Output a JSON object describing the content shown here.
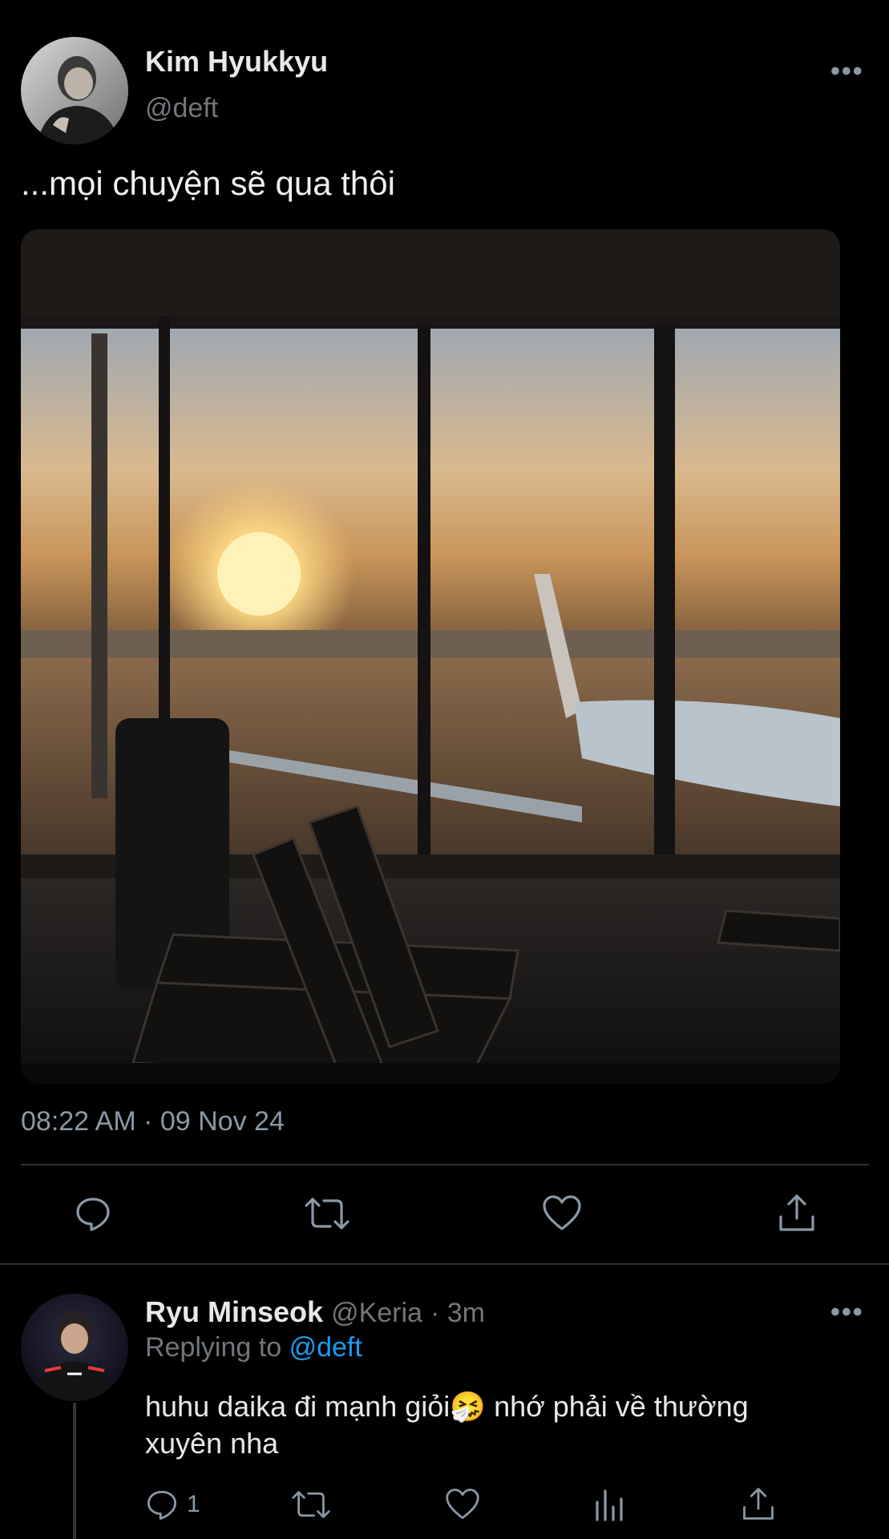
{
  "tweet": {
    "author_name": "Kim Hyukkyu",
    "author_handle": "@deft",
    "text": "...mọi chuyện sẽ qua thôi",
    "timestamp": "08:22 AM · 09 Nov 24",
    "more_icon": "more-horizontal-icon"
  },
  "reply": {
    "author_name": "Ryu Minseok",
    "author_handle": "@Keria",
    "time_ago": "· 3m",
    "replying_prefix": "Replying to",
    "replying_to": "@deft",
    "text_line1": "huhu daika đi mạnh giỏi🤧  nhớ phải về thường",
    "text_line2": "xuyên nha",
    "reply_count": "1"
  },
  "colors": {
    "background": "#000000",
    "text": "#e7e9ea",
    "muted": "#71767b",
    "link": "#1d9bf0",
    "divider": "#2f3336"
  }
}
